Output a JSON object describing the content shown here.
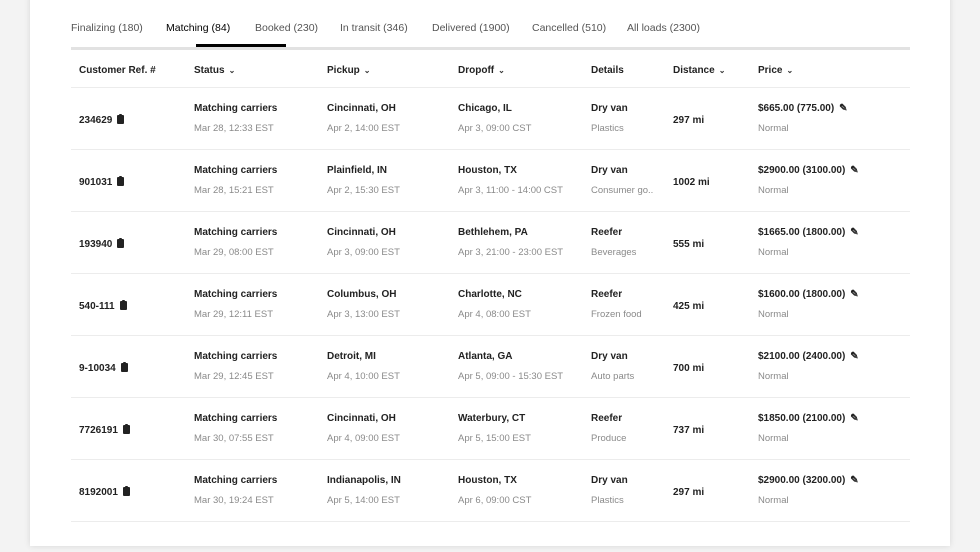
{
  "tabs": [
    {
      "label": "Finalizing (180)",
      "active": false
    },
    {
      "label": "Matching (84)",
      "active": true
    },
    {
      "label": "Booked (230)",
      "active": false
    },
    {
      "label": "In transit (346)",
      "active": false
    },
    {
      "label": "Delivered (1900)",
      "active": false
    },
    {
      "label": "Cancelled (510)",
      "active": false
    },
    {
      "label": "All loads (2300)",
      "active": false
    }
  ],
  "columns": {
    "ref": "Customer Ref. #",
    "status": "Status",
    "pickup": "Pickup",
    "dropoff": "Dropoff",
    "details": "Details",
    "distance": "Distance",
    "price": "Price"
  },
  "icons": {
    "caret": "chevron-down-icon",
    "clipboard": "clipboard-icon",
    "edit": "pencil-icon"
  },
  "rows": [
    {
      "ref": "234629",
      "status": "Matching carriers",
      "status_time": "Mar 28, 12:33 EST",
      "pickup_city": "Cincinnati, OH",
      "pickup_time": "Apr 2, 14:00 EST",
      "dropoff_city": "Chicago, IL",
      "dropoff_time": "Apr 3, 09:00 CST",
      "equipment": "Dry van",
      "commodity": "Plastics",
      "distance": "297 mi",
      "price": "$665.00 (775.00)",
      "priority": "Normal"
    },
    {
      "ref": "901031",
      "status": "Matching carriers",
      "status_time": "Mar 28, 15:21 EST",
      "pickup_city": "Plainfield, IN",
      "pickup_time": "Apr 2, 15:30 EST",
      "dropoff_city": "Houston, TX",
      "dropoff_time": "Apr 3, 11:00 - 14:00 CST",
      "equipment": "Dry van",
      "commodity": "Consumer go..",
      "distance": "1002 mi",
      "price": "$2900.00 (3100.00)",
      "priority": "Normal"
    },
    {
      "ref": "193940",
      "status": "Matching carriers",
      "status_time": "Mar 29, 08:00 EST",
      "pickup_city": "Cincinnati, OH",
      "pickup_time": "Apr 3, 09:00 EST",
      "dropoff_city": "Bethlehem, PA",
      "dropoff_time": "Apr 3, 21:00 - 23:00 EST",
      "equipment": "Reefer",
      "commodity": "Beverages",
      "distance": "555 mi",
      "price": "$1665.00 (1800.00)",
      "priority": "Normal"
    },
    {
      "ref": "540-111",
      "status": "Matching carriers",
      "status_time": "Mar 29, 12:11 EST",
      "pickup_city": "Columbus, OH",
      "pickup_time": "Apr 3, 13:00 EST",
      "dropoff_city": "Charlotte, NC",
      "dropoff_time": "Apr 4, 08:00 EST",
      "equipment": "Reefer",
      "commodity": "Frozen food",
      "distance": "425 mi",
      "price": "$1600.00 (1800.00)",
      "priority": "Normal"
    },
    {
      "ref": "9-10034",
      "status": "Matching carriers",
      "status_time": "Mar 29, 12:45 EST",
      "pickup_city": "Detroit, MI",
      "pickup_time": "Apr 4, 10:00 EST",
      "dropoff_city": "Atlanta, GA",
      "dropoff_time": "Apr 5, 09:00 - 15:30 EST",
      "equipment": "Dry van",
      "commodity": "Auto parts",
      "distance": "700 mi",
      "price": "$2100.00 (2400.00)",
      "priority": "Normal"
    },
    {
      "ref": "7726191",
      "status": "Matching carriers",
      "status_time": "Mar 30, 07:55 EST",
      "pickup_city": "Cincinnati, OH",
      "pickup_time": "Apr 4, 09:00 EST",
      "dropoff_city": "Waterbury, CT",
      "dropoff_time": "Apr 5, 15:00 EST",
      "equipment": "Reefer",
      "commodity": "Produce",
      "distance": "737 mi",
      "price": "$1850.00 (2100.00)",
      "priority": "Normal"
    },
    {
      "ref": "8192001",
      "status": "Matching carriers",
      "status_time": "Mar 30, 19:24 EST",
      "pickup_city": "Indianapolis, IN",
      "pickup_time": "Apr 5, 14:00 EST",
      "dropoff_city": "Houston, TX",
      "dropoff_time": "Apr 6, 09:00 CST",
      "equipment": "Dry van",
      "commodity": "Plastics",
      "distance": "297 mi",
      "price": "$2900.00 (3200.00)",
      "priority": "Normal"
    }
  ]
}
